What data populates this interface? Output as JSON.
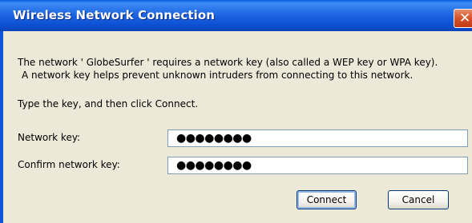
{
  "window": {
    "title": "Wireless Network Connection",
    "close_glyph": "✕"
  },
  "message": {
    "line1": "The network ' GlobeSurfer ' requires a network key (also called a WEP key or WPA key).",
    "line2": "A network key helps prevent unknown intruders from connecting to this network.",
    "instruction": "Type the key, and then click Connect."
  },
  "fields": {
    "network_key_label": "Network key:",
    "network_key_value": "●●●●●●●●",
    "confirm_key_label": "Confirm network key:",
    "confirm_key_value": "●●●●●●●●"
  },
  "buttons": {
    "connect": "Connect",
    "cancel": "Cancel"
  },
  "colors": {
    "titlebar": "#0a5ee0",
    "close_button": "#d5522a",
    "dialog_background": "#ece9d8"
  }
}
